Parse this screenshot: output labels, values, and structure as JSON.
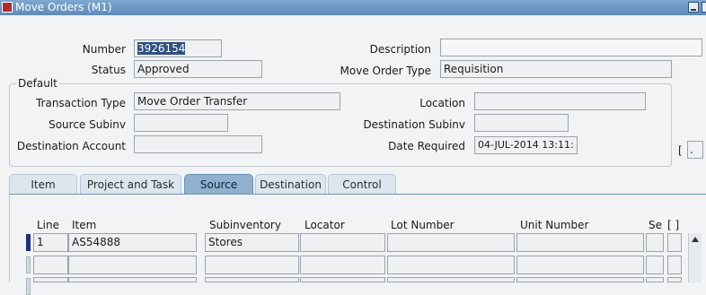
{
  "window": {
    "title": "Move Orders (M1)"
  },
  "header": {
    "number_label": "Number",
    "number_value": "3926154",
    "description_label": "Description",
    "description_value": "",
    "status_label": "Status",
    "status_value": "Approved",
    "move_order_type_label": "Move Order Type",
    "move_order_type_value": "Requisition"
  },
  "default_group": {
    "title": "Default",
    "transaction_type_label": "Transaction Type",
    "transaction_type_value": "Move Order Transfer",
    "location_label": "Location",
    "location_value": "",
    "source_subinv_label": "Source Subinv",
    "source_subinv_value": "",
    "destination_subinv_label": "Destination Subinv",
    "destination_subinv_value": "",
    "destination_account_label": "Destination Account",
    "destination_account_value": "",
    "date_required_label": "Date Required",
    "date_required_value": "04-JUL-2014 13:11:",
    "side_bracket": "[",
    "side_field": "."
  },
  "tabs": [
    "Item",
    "Project and Task",
    "Source",
    "Destination",
    "Control"
  ],
  "active_tab": "Source",
  "lines_table": {
    "columns": [
      "Line",
      "Item",
      "Subinventory",
      "Locator",
      "Lot Number",
      "Unit Number",
      "Se",
      "[ ]"
    ],
    "rows": [
      {
        "line": "1",
        "item": "AS54888",
        "subinventory": "Stores",
        "locator": "",
        "lot_number": "",
        "unit_number": ""
      },
      {
        "line": "",
        "item": "",
        "subinventory": "",
        "locator": "",
        "lot_number": "",
        "unit_number": ""
      },
      {
        "line": "",
        "item": "",
        "subinventory": "",
        "locator": "",
        "lot_number": "",
        "unit_number": ""
      }
    ]
  }
}
